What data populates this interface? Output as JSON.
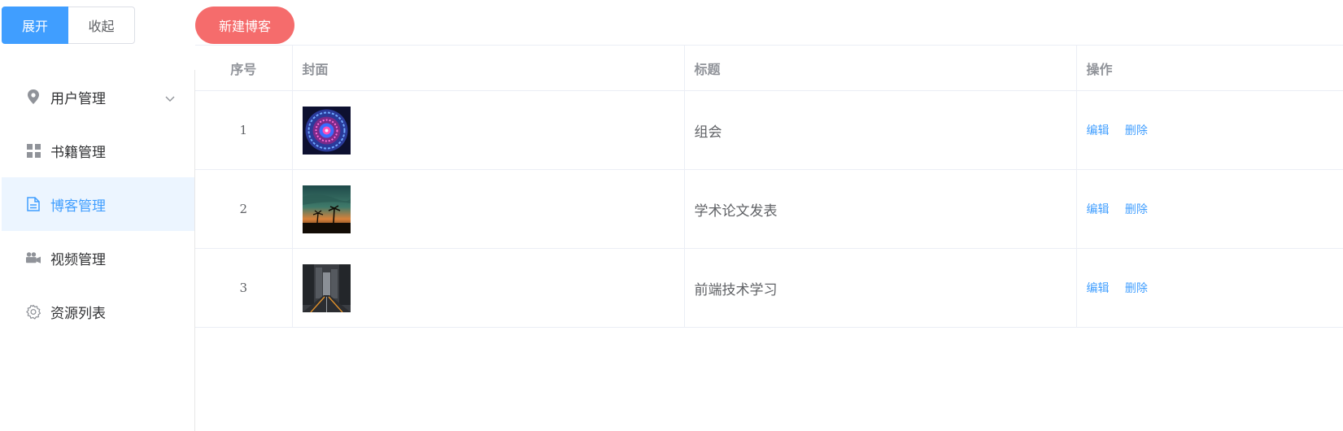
{
  "toolbar": {
    "expand_label": "展开",
    "collapse_label": "收起",
    "new_blog_label": "新建博客"
  },
  "sidebar": {
    "items": [
      {
        "label": "用户管理",
        "icon": "location-icon",
        "active": false,
        "has_submenu": true
      },
      {
        "label": "书籍管理",
        "icon": "grid-icon",
        "active": false
      },
      {
        "label": "博客管理",
        "icon": "document-icon",
        "active": true
      },
      {
        "label": "视频管理",
        "icon": "video-camera-icon",
        "active": false
      },
      {
        "label": "资源列表",
        "icon": "settings-gear-icon",
        "active": false
      }
    ]
  },
  "table": {
    "columns": [
      "序号",
      "封面",
      "标题",
      "操作"
    ],
    "rows": [
      {
        "index": "1",
        "cover": "kaleidoscope-mandala",
        "title": "组会",
        "edit": "编辑",
        "delete": "删除"
      },
      {
        "index": "2",
        "cover": "tropical-sunset-palms",
        "title": "学术论文发表",
        "edit": "编辑",
        "delete": "删除"
      },
      {
        "index": "3",
        "cover": "rainy-city-street",
        "title": "前端技术学习",
        "edit": "编辑",
        "delete": "删除"
      }
    ]
  },
  "colors": {
    "primary": "#409eff",
    "danger": "#f56c6c",
    "active_bg": "#ecf5ff"
  }
}
